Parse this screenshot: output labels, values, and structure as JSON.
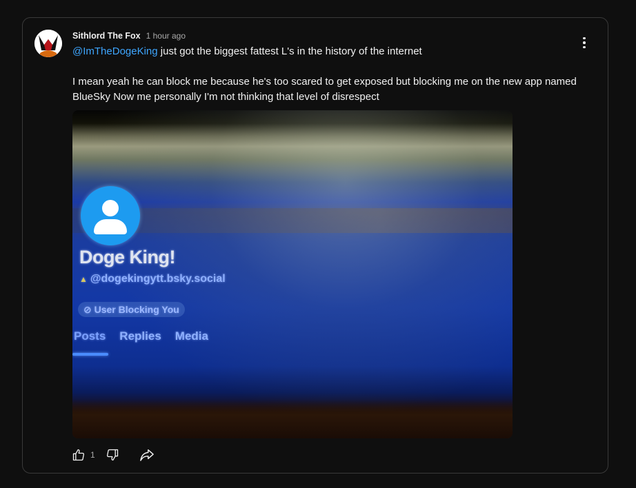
{
  "comment": {
    "author": "Sithlord The Fox",
    "timestamp": "1 hour ago",
    "mention": "@ImTheDogeKing",
    "text_after_mention": " just got the biggest fattest L's in the history of the internet",
    "paragraph_2": "I mean yeah he can block me because he's too scared to get exposed but blocking me on the new app named BlueSky Now me personally I'm not thinking that level of disrespect",
    "like_count": "1",
    "icons": {
      "avatar": "fox-avatar",
      "menu": "more-vert-icon",
      "like": "thumbs-up-icon",
      "dislike": "thumbs-down-icon",
      "share": "share-icon"
    },
    "accent_color": "#3ea6ff"
  },
  "attached_image": {
    "profile_name": "Doge King!",
    "handle": "@dogekingytt.bsky.social",
    "badge": "⊘ User Blocking You",
    "tabs": [
      "Posts",
      "Replies",
      "Media"
    ]
  }
}
